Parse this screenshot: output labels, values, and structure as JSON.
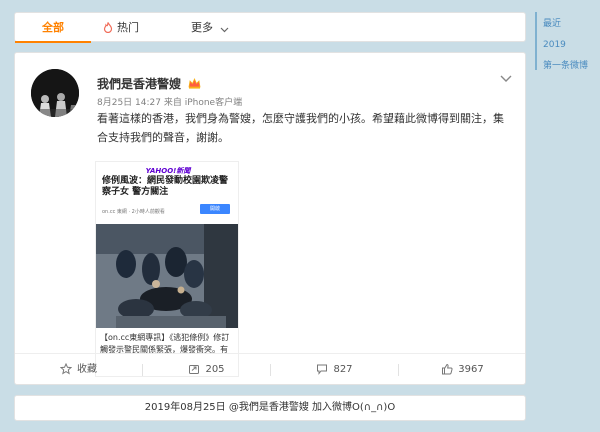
{
  "tabs": {
    "all": "全部",
    "hot": "热门",
    "more": "更多"
  },
  "post": {
    "author": "我們是香港警嫂",
    "meta": "8月25日 14:27 来自 iPhone客户端",
    "body": "看著這樣的香港，我們身為警嫂，怎麼守護我們的小孩。希望藉此微博得到關注，集合支持我們的聲音，謝謝。",
    "preview": {
      "logo": "YAHOO!新聞",
      "title": "修例風波：網民發動校園欺凌警察子女 警方關注",
      "source": "on.cc 東網 · 2小時人前觀看",
      "open_label": "開啟",
      "caption": "【on.cc東網專訊】《逃犯條例》修訂觸發示警民關係緊張，爆發衝突。有"
    },
    "actions": {
      "collect": "收藏",
      "repost": "205",
      "comment": "827",
      "like": "3967"
    }
  },
  "footer": {
    "text": "2019年08月25日 @我們是香港警嫂 加入微博O(∩_∩)O"
  },
  "timeline": {
    "recent": "最近",
    "year": "2019",
    "first": "第一条微博"
  },
  "colors": {
    "accent": "#ff8200",
    "background": "#c9dde6",
    "timeline": "#4a8bbf"
  }
}
